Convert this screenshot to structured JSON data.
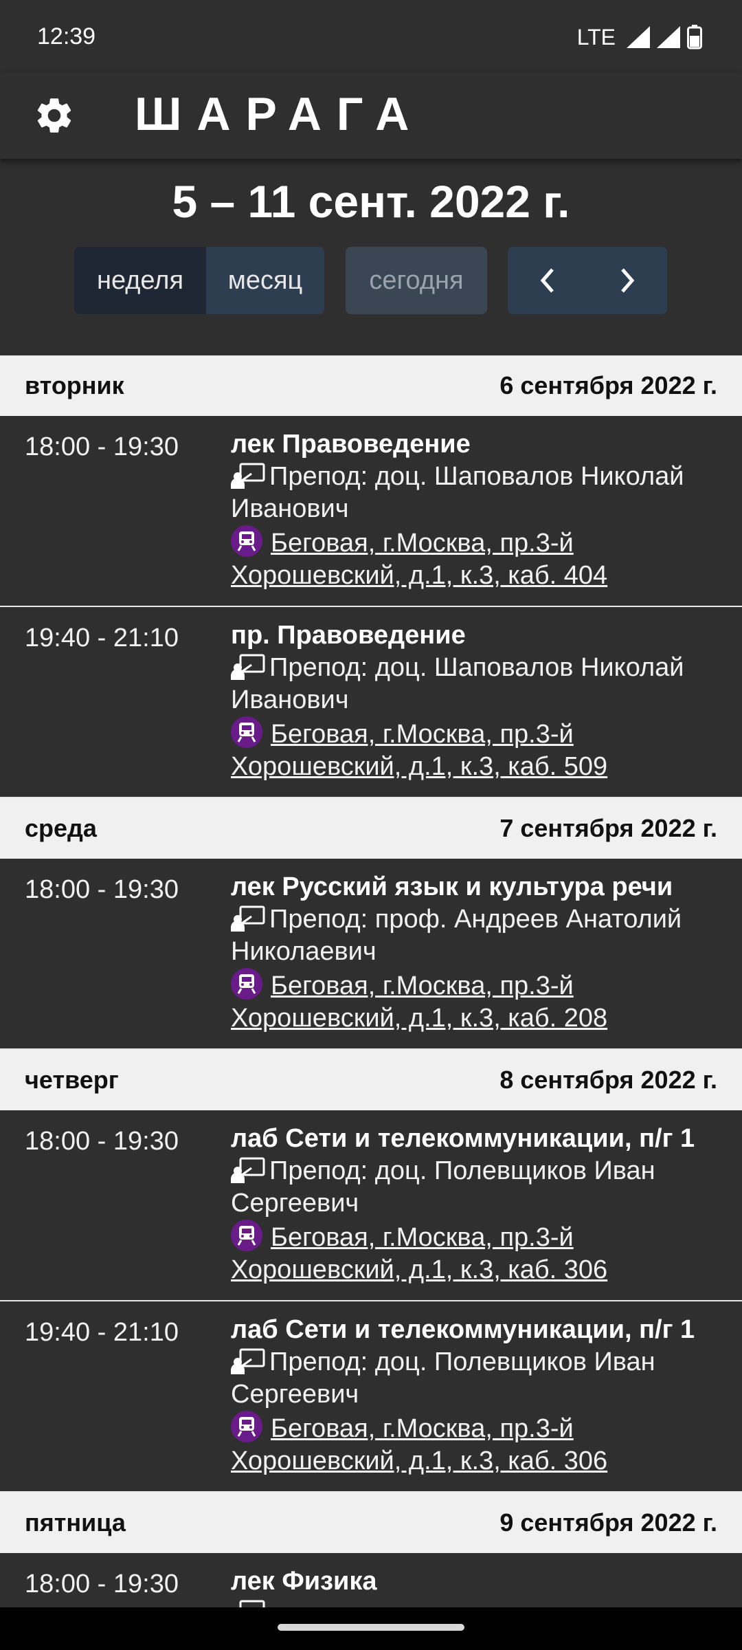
{
  "status_bar": {
    "time": "12:39",
    "network": "LTE"
  },
  "app_bar": {
    "title": "ШАРАГА",
    "settings_icon": "gear-icon"
  },
  "calendar": {
    "date_range": "5 – 11 сент. 2022 г.",
    "view_week": "неделя",
    "view_month": "месяц",
    "today": "сегодня",
    "prev_icon": "chevron-left-icon",
    "next_icon": "chevron-right-icon"
  },
  "days": [
    {
      "weekday": "вторник",
      "date": "6 сентября 2022 г.",
      "events": [
        {
          "time": "18:00 - 19:30",
          "title": "лек Правоведение",
          "teacher": "Препод: доц. Шаповалов Николай Иванович",
          "location": "Беговая, г.Москва, пр.3-й Хорошевский, д.1, к.3, каб. 404"
        },
        {
          "time": "19:40 - 21:10",
          "title": "пр. Правоведение",
          "teacher": "Препод: доц. Шаповалов Николай Иванович",
          "location": "Беговая, г.Москва, пр.3-й Хорошевский, д.1, к.3, каб. 509"
        }
      ]
    },
    {
      "weekday": "среда",
      "date": "7 сентября 2022 г.",
      "events": [
        {
          "time": "18:00 - 19:30",
          "title": "лек Русский язык и культура речи",
          "teacher": "Препод: проф. Андреев Анатолий Николаевич",
          "location": "Беговая, г.Москва, пр.3-й Хорошевский, д.1, к.3, каб. 208"
        }
      ]
    },
    {
      "weekday": "четверг",
      "date": "8 сентября 2022 г.",
      "events": [
        {
          "time": "18:00 - 19:30",
          "title": "лаб Сети и телекоммуникации, п/г 1",
          "teacher": "Препод: доц. Полевщиков Иван Сергеевич",
          "location": "Беговая, г.Москва, пр.3-й Хорошевский, д.1, к.3, каб. 306"
        },
        {
          "time": "19:40 - 21:10",
          "title": "лаб Сети и телекоммуникации, п/г 1",
          "teacher": "Препод: доц. Полевщиков Иван Сергеевич",
          "location": "Беговая, г.Москва, пр.3-й Хорошевский, д.1, к.3, каб. 306"
        }
      ]
    },
    {
      "weekday": "пятница",
      "date": "9 сентября 2022 г.",
      "events": [
        {
          "time": "18:00 - 19:30",
          "title": "лек Физика",
          "teacher": "",
          "location": ""
        }
      ]
    }
  ],
  "colors": {
    "background": "#2f2f2f",
    "day_header": "#f0f0f0",
    "button_active": "#1e2733",
    "button": "#2c3e50",
    "metro": "#6a1b8a"
  }
}
